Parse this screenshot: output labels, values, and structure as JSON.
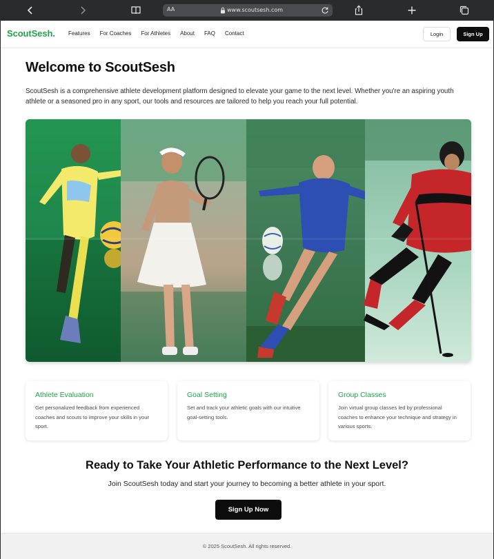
{
  "browser": {
    "reader_label": "AA",
    "url": "www.scoutsesh.com"
  },
  "nav": {
    "brand": "ScoutSesh.",
    "links": [
      "Features",
      "For Coaches",
      "For Athletes",
      "About",
      "FAQ",
      "Contact"
    ],
    "login_label": "Login",
    "signup_label": "Sign Up"
  },
  "hero": {
    "title": "Welcome to ScoutSesh",
    "intro": "ScoutSesh is a comprehensive athlete development platform designed to elevate your game to the next level. Whether you're an aspiring youth athlete or a seasoned pro in any sport, our tools and resources are tailored to help you reach your full potential."
  },
  "features": [
    {
      "title": "Athlete Evaluation",
      "text": "Get personalized feedback from experienced coaches and scouts to improve your skills in your sport."
    },
    {
      "title": "Goal Setting",
      "text": "Set and track your athletic goals with our intuitive goal-setting tools."
    },
    {
      "title": "Group Classes",
      "text": "Join virtual group classes led by professional coaches to enhance your technique and strategy in various sports."
    }
  ],
  "cta": {
    "title": "Ready to Take Your Athletic Performance to the Next Level?",
    "subtitle": "Join ScoutSesh today and start your journey to becoming a better athlete in your sport.",
    "button_label": "Sign Up Now"
  },
  "footer": {
    "copyright": "© 2025 ScoutSesh. All rights reserved."
  },
  "colors": {
    "brand_green": "#1fa347",
    "button_dark": "#0d0d0d",
    "chrome_bg": "#2a2b2d"
  },
  "icons": [
    "back-arrow-icon",
    "forward-arrow-icon",
    "bookmarks-icon",
    "lock-icon",
    "reload-icon",
    "share-icon",
    "new-tab-icon",
    "tabs-icon"
  ]
}
